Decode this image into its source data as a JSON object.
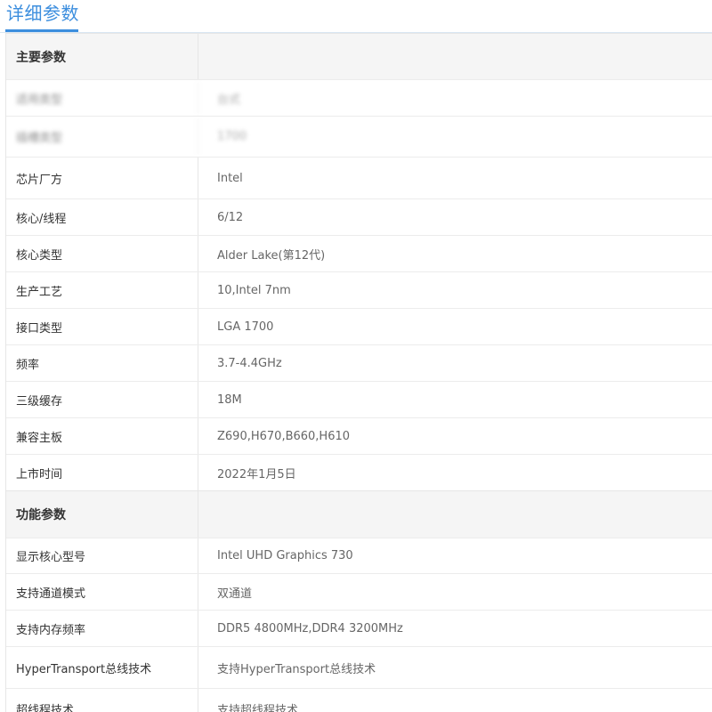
{
  "header": {
    "title": "详细参数"
  },
  "sections": [
    {
      "title": "主要参数",
      "rows": [
        {
          "label": "适用类型",
          "value": "台式"
        },
        {
          "label": "插槽类型",
          "value": "1700"
        },
        {
          "label": "芯片厂方",
          "value": "Intel"
        },
        {
          "label": "核心/线程",
          "value": "6/12"
        },
        {
          "label": "核心类型",
          "value": "Alder Lake(第12代)"
        },
        {
          "label": "生产工艺",
          "value": "10,Intel 7nm"
        },
        {
          "label": "接口类型",
          "value": "LGA 1700"
        },
        {
          "label": "频率",
          "value": "3.7-4.4GHz"
        },
        {
          "label": "三级缓存",
          "value": "18M"
        },
        {
          "label": "兼容主板",
          "value": "Z690,H670,B660,H610"
        },
        {
          "label": "上市时间",
          "value": "2022年1月5日"
        }
      ]
    },
    {
      "title": "功能参数",
      "rows": [
        {
          "label": "显示核心型号",
          "value": "Intel UHD Graphics 730"
        },
        {
          "label": "支持通道模式",
          "value": "双通道"
        },
        {
          "label": "支持内存频率",
          "value": "DDR5 4800MHz,DDR4 3200MHz"
        },
        {
          "label": "HyperTransport总线技术",
          "value": "支持HyperTransport总线技术"
        },
        {
          "label": "超线程技术",
          "value": "支持超线程技术"
        }
      ]
    }
  ],
  "colors": {
    "accent": "#3c8ede",
    "section_bg": "#f5f5f5",
    "border": "#e6e6e6"
  }
}
